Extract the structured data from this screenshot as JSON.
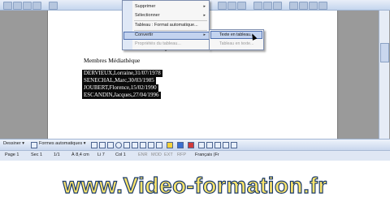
{
  "menu": {
    "items": [
      {
        "label": "Supprimer",
        "submenu": true,
        "greyed": false
      },
      {
        "label": "Sélectionner",
        "submenu": true,
        "greyed": false
      },
      {
        "label": "Tableau : Format automatique...",
        "submenu": false,
        "greyed": false
      },
      {
        "label": "Convertir",
        "submenu": true,
        "greyed": false
      },
      {
        "label": "Propriétés du tableau...",
        "submenu": false,
        "greyed": true
      }
    ]
  },
  "submenu": {
    "items": [
      {
        "label": "Texte en tableau...",
        "greyed": false
      },
      {
        "label": "Tableau en texte...",
        "greyed": true
      }
    ]
  },
  "document": {
    "title": "Membres Médiathèque",
    "rows": [
      "DERVIEUX,Lorraine,31/07/1978",
      "SENECHAL,Marc,30/03/1985",
      "JOUBERT,Florence,15/02/1990",
      "ESCANDIN,Jacques,27/04/1996"
    ]
  },
  "drawing_toolbar": {
    "draw_label": "Dessiner ▾",
    "autoshapes_label": "Formes automatiques ▾"
  },
  "status_bar": {
    "page": "Page  1",
    "section": "Sec  1",
    "page_count": "1/1",
    "position": "À  8,4 cm",
    "line": "Li  7",
    "column": "Col  1",
    "modes": [
      "ENR",
      "MOD",
      "EXT",
      "RFP"
    ],
    "language": "Français (Fr"
  },
  "watermark": "www.Video-formation.fr"
}
